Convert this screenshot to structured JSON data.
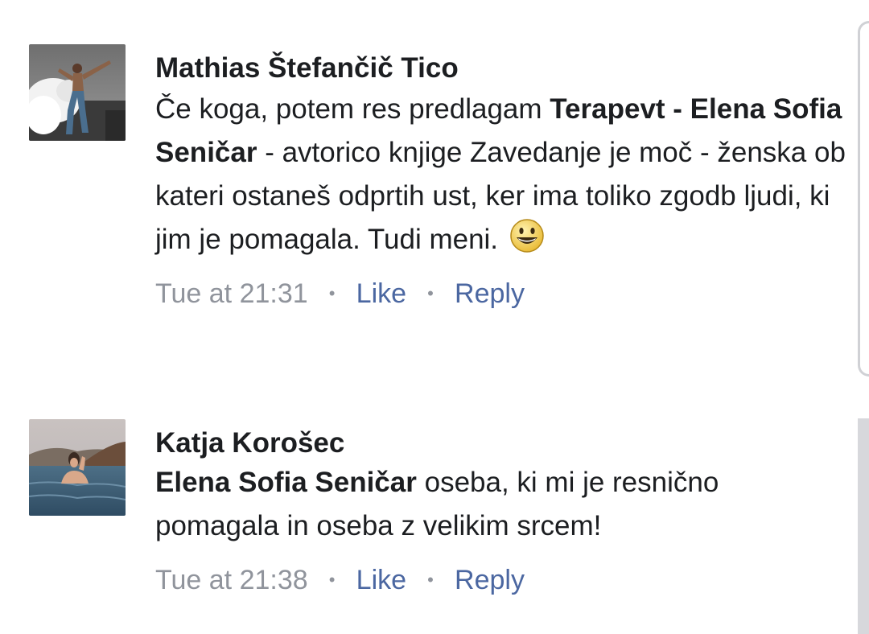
{
  "comments": [
    {
      "author": "Mathias Štefančič Tico",
      "text": {
        "part1": "Če koga, potem res predlagam ",
        "mention": "Terapevt - Elena Sofia Seničar",
        "part2": " - avtorico knjige Zavedanje je moč - ženska ob kateri ostaneš odprtih ust, ker ima toliko zgodb ljudi, ki jim je pomagala. Tudi meni."
      },
      "emoji": "grinning-face",
      "time": "Tue at 21:31",
      "like_label": "Like",
      "reply_label": "Reply",
      "separator": "•"
    },
    {
      "author": "Katja Korošec",
      "text": {
        "mention": "Elena Sofia Seničar",
        "part2": " oseba, ki mi je resnično pomagala in oseba z velikim srcem!"
      },
      "time": "Tue at 21:38",
      "like_label": "Like",
      "reply_label": "Reply",
      "separator": "•"
    }
  ],
  "colors": {
    "text": "#1c1e21",
    "meta": "#90949c",
    "link": "#4b67a1",
    "scrollbar": "#d7d8dc"
  }
}
